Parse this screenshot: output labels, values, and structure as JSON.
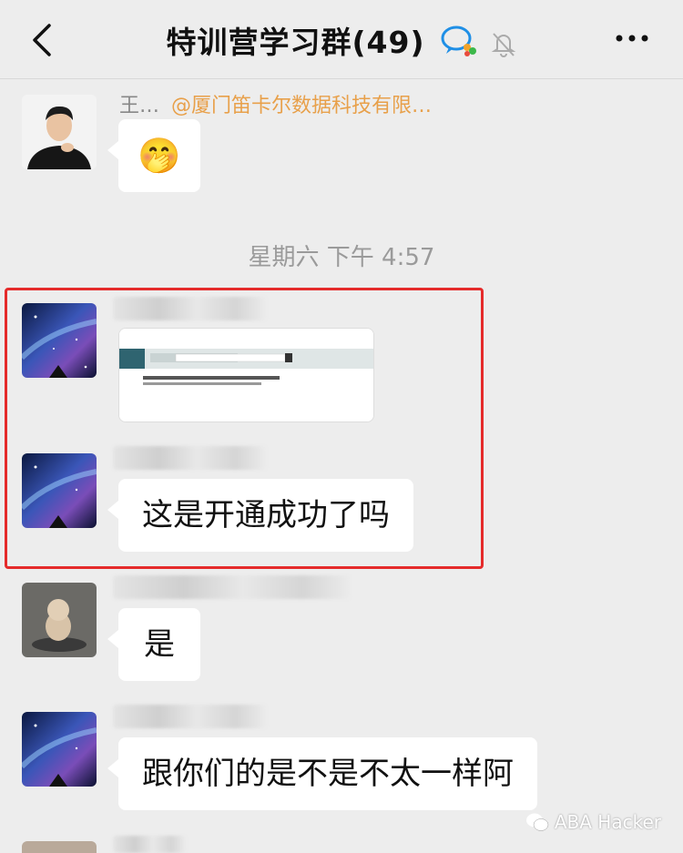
{
  "header": {
    "title": "特训营学习群(49)"
  },
  "messages": [
    {
      "sender_name": "王…",
      "sender_org": "@厦门笛卡尔数据科技有限…",
      "content": "🤭"
    },
    {
      "timestamp": "星期六 下午 4:57"
    },
    {
      "content_type": "screenshot-image"
    },
    {
      "content": "这是开通成功了吗"
    },
    {
      "content": "是"
    },
    {
      "content": "跟你们的是不是不太一样阿"
    }
  ],
  "watermark": {
    "text": "ABA Hacker"
  },
  "colors": {
    "background": "#ededed",
    "bubble": "#ffffff",
    "highlight": "#e52b2b",
    "org_text": "#e8a04a"
  }
}
